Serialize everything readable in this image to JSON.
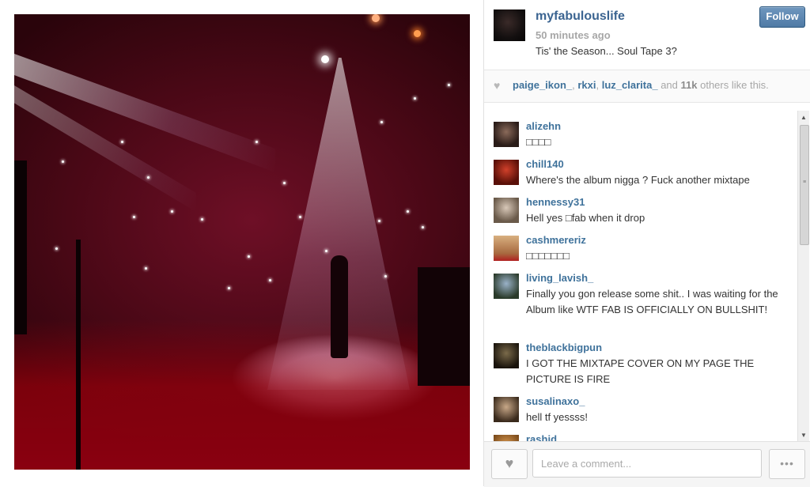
{
  "post": {
    "username": "myfabulouslife",
    "timestamp": "50 minutes ago",
    "caption": "Tis' the Season... Soul Tape 3?",
    "follow_label": "Follow"
  },
  "likes": {
    "users": [
      "paige_ikon_",
      "rkxi",
      "luz_clarita_"
    ],
    "sep1": ", ",
    "sep2": ", ",
    "and": " and ",
    "count": "11k",
    "suffix": " others like this."
  },
  "comments": [
    {
      "user": "alizehn",
      "text": "□□□□"
    },
    {
      "user": "chill140",
      "text": "Where's the album nigga ? Fuck another mixtape"
    },
    {
      "user": "hennessy31",
      "text": "Hell yes □fab when it drop"
    },
    {
      "user": "cashmereriz",
      "text": "□□□□□□□"
    },
    {
      "user": "living_lavish_",
      "text": "Finally you gon release some shit.. I was waiting for the Album like WTF FAB IS OFFICIALLY ON BULLSHIT!"
    },
    {
      "user": "theblackbigpun",
      "text": "I GOT THE MIXTAPE COVER ON MY PAGE THE PICTURE IS FIRE"
    },
    {
      "user": "susalinaxo_",
      "text": "hell tf yessss!"
    },
    {
      "user": "rashid",
      "text": ""
    }
  ],
  "footer": {
    "comment_placeholder": "Leave a comment...",
    "more_label": "•••",
    "like_icon": "♥"
  },
  "icons": {
    "heart": "♥",
    "scroll_up": "▲",
    "scroll_down": "▼",
    "grip": "≡"
  },
  "colors": {
    "link": "#3f729b",
    "follow_button": "#4f7aa5"
  }
}
